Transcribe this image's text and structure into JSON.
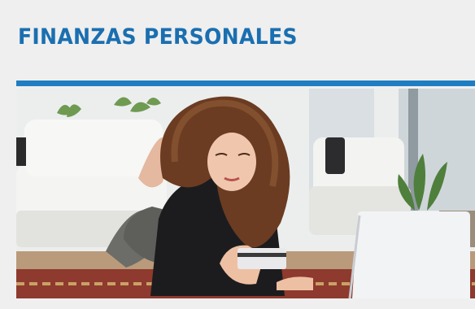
{
  "section": {
    "title": "FINANZAS PERSONALES"
  },
  "colors": {
    "accent": "#1f7ec2",
    "title_text": "#1a6fb0",
    "background": "#efefef"
  },
  "photo": {
    "subject": "photo-woman-with-credit-card-and-laptop"
  }
}
